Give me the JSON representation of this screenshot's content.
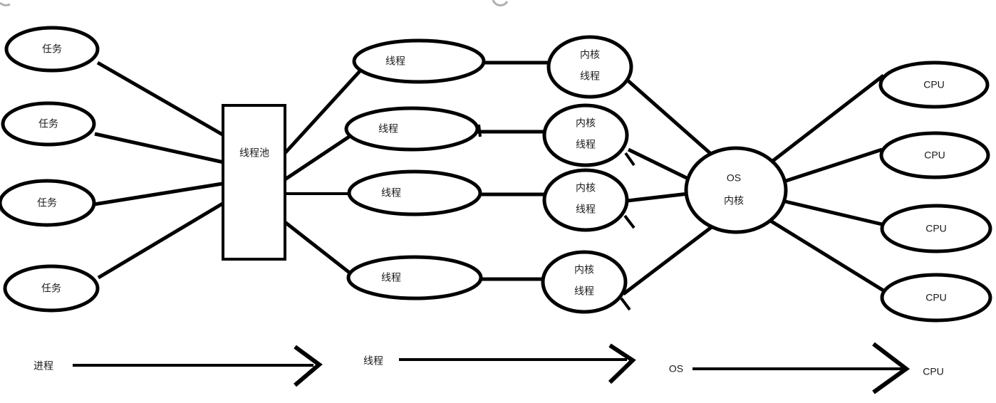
{
  "diagram": {
    "title": "Thread pool / kernel thread / CPU mapping diagram",
    "background_color": "#ffffff",
    "stroke_color": "#000000",
    "text_color": "#1a1a1a"
  },
  "tasks": [
    {
      "label": "任务"
    },
    {
      "label": "任务"
    },
    {
      "label": "任务"
    },
    {
      "label": "任务"
    }
  ],
  "thread_pool": {
    "label": "线程池"
  },
  "threads": [
    {
      "label": "线程"
    },
    {
      "label": "线程"
    },
    {
      "label": "线程"
    },
    {
      "label": "线程"
    }
  ],
  "kernel_threads": [
    {
      "line1": "内核",
      "line2": "线程"
    },
    {
      "line1": "内核",
      "line2": "线程"
    },
    {
      "line1": "内核",
      "line2": "线程"
    },
    {
      "line1": "内核",
      "line2": "线程"
    }
  ],
  "os_kernel": {
    "line1": "OS",
    "line2": "内核"
  },
  "cpus": [
    {
      "label": "CPU"
    },
    {
      "label": "CPU"
    },
    {
      "label": "CPU"
    },
    {
      "label": "CPU"
    }
  ],
  "legend": {
    "arrows": [
      {
        "left_label": "进程",
        "right_label": ""
      },
      {
        "left_label": "线程",
        "right_label": ""
      },
      {
        "left_label": "OS",
        "right_label": "CPU"
      }
    ]
  }
}
